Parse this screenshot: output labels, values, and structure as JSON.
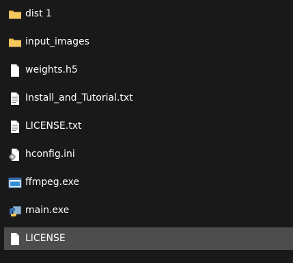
{
  "files": {
    "items": [
      {
        "name": "dist 1",
        "icon": "folder-icon",
        "type": "folder"
      },
      {
        "name": "input_images",
        "icon": "folder-icon",
        "type": "folder"
      },
      {
        "name": "weights.h5",
        "icon": "file-icon",
        "type": "file"
      },
      {
        "name": "Install_and_Tutorial.txt",
        "icon": "text-file-icon",
        "type": "text"
      },
      {
        "name": "LICENSE.txt",
        "icon": "text-file-icon",
        "type": "text"
      },
      {
        "name": "hconfig.ini",
        "icon": "config-file-icon",
        "type": "config"
      },
      {
        "name": "ffmpeg.exe",
        "icon": "application-icon",
        "type": "app"
      },
      {
        "name": "main.exe",
        "icon": "python-app-icon",
        "type": "pyapp"
      },
      {
        "name": "LICENSE",
        "icon": "file-icon",
        "type": "file"
      }
    ],
    "selected_index": 8
  },
  "colors": {
    "background": "#191919",
    "selected_row": "#4d4d4d",
    "folder": "#f2c55c",
    "text": "#ffffff"
  }
}
